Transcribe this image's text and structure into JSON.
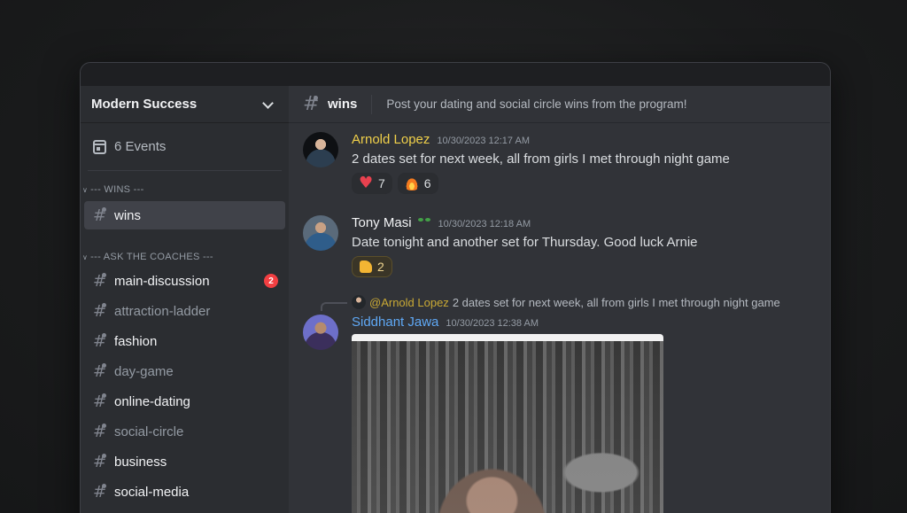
{
  "server": {
    "name": "Modern Success"
  },
  "events": {
    "label": "6 Events"
  },
  "categories": [
    {
      "label": "--- WINS ---"
    },
    {
      "label": "--- ASK THE COACHES ---"
    }
  ],
  "channels": [
    {
      "name": "wins"
    },
    {
      "name": "main-discussion",
      "badge": "2"
    },
    {
      "name": "attraction-ladder"
    },
    {
      "name": "fashion"
    },
    {
      "name": "day-game"
    },
    {
      "name": "online-dating"
    },
    {
      "name": "social-circle"
    },
    {
      "name": "business"
    },
    {
      "name": "social-media"
    }
  ],
  "header": {
    "channel": "wins",
    "topic": "Post your dating and social circle wins from the program!"
  },
  "messages": [
    {
      "author": "Arnold Lopez",
      "author_color": "#f0d04a",
      "time": "10/30/2023 12:17 AM",
      "text": "2 dates set for next week, all from girls I met through night game",
      "reactions": [
        {
          "icon": "heart-icon",
          "count": "7"
        },
        {
          "icon": "fire-icon",
          "count": "6"
        }
      ]
    },
    {
      "author": "Tony Masi",
      "author_color": "#f2f3f5",
      "time": "10/30/2023 12:18 AM",
      "text": "Date tonight and another set for Thursday. Good luck Arnie",
      "reactions": [
        {
          "icon": "thumb-icon",
          "count": "2"
        }
      ]
    },
    {
      "reply_mention": "@Arnold Lopez",
      "reply_text": "2 dates set for next week, all from girls I met through night game",
      "author": "Siddhant Jawa",
      "author_color": "#5fa8f5",
      "time": "10/30/2023 12:38 AM"
    }
  ]
}
